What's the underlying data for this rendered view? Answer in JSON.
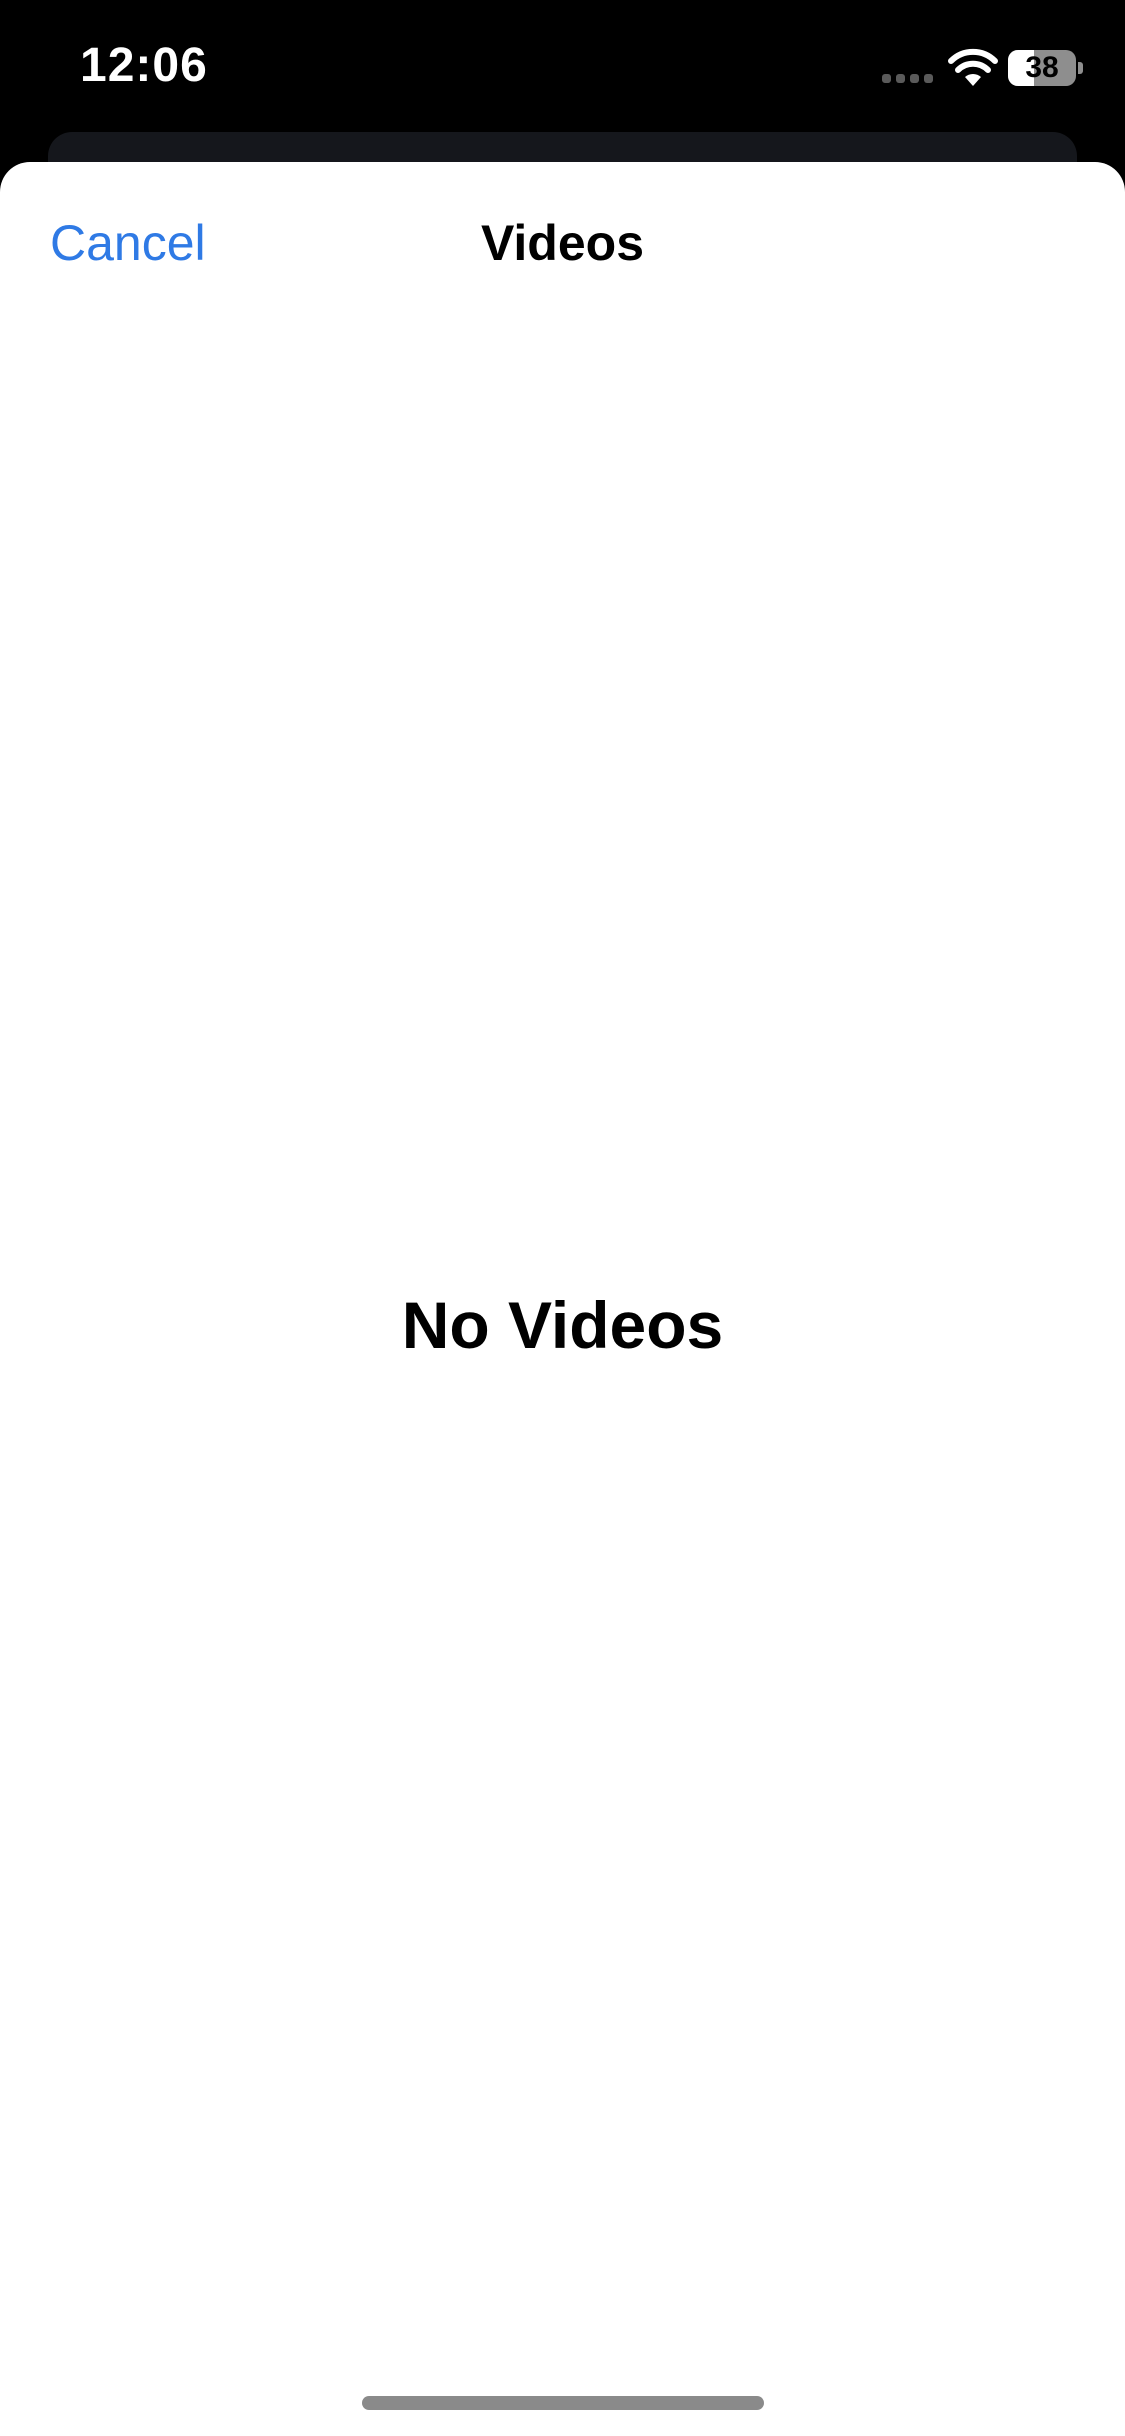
{
  "status_bar": {
    "time": "12:06",
    "battery_level": "38",
    "battery_fraction": 0.38,
    "signal_icon": "cellular-signal-icon",
    "wifi_icon": "wifi-icon",
    "battery_icon": "battery-icon"
  },
  "sheet": {
    "cancel_label": "Cancel",
    "title": "Videos",
    "empty_message": "No Videos"
  },
  "colors": {
    "accent": "#2f7ae5",
    "background": "#000000",
    "sheet": "#ffffff"
  }
}
